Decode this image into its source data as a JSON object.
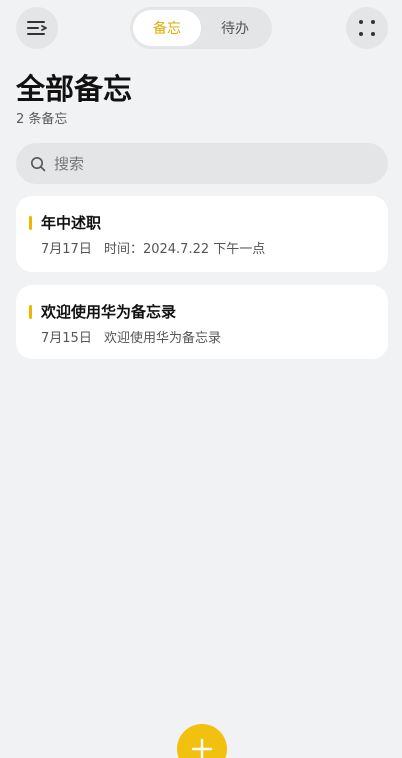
{
  "header": {
    "menu_icon": "menu-icon",
    "tabs": [
      {
        "label": "备忘",
        "active": true
      },
      {
        "label": "待办",
        "active": false
      }
    ],
    "more_icon": "more-dots-icon"
  },
  "page": {
    "title": "全部备忘",
    "count_text": "2 条备忘"
  },
  "search": {
    "placeholder": "搜索",
    "icon": "search-icon"
  },
  "notes": [
    {
      "title": "年中述职",
      "date": "7月17日",
      "preview": "时间：2024.7.22 下午一点"
    },
    {
      "title": "欢迎使用华为备忘录",
      "date": "7月15日",
      "preview": "欢迎使用华为备忘录"
    }
  ],
  "fab": {
    "icon": "plus-icon"
  },
  "colors": {
    "accent": "#f2c00e",
    "accent_text": "#e3a900",
    "background": "#f1f2f4"
  }
}
